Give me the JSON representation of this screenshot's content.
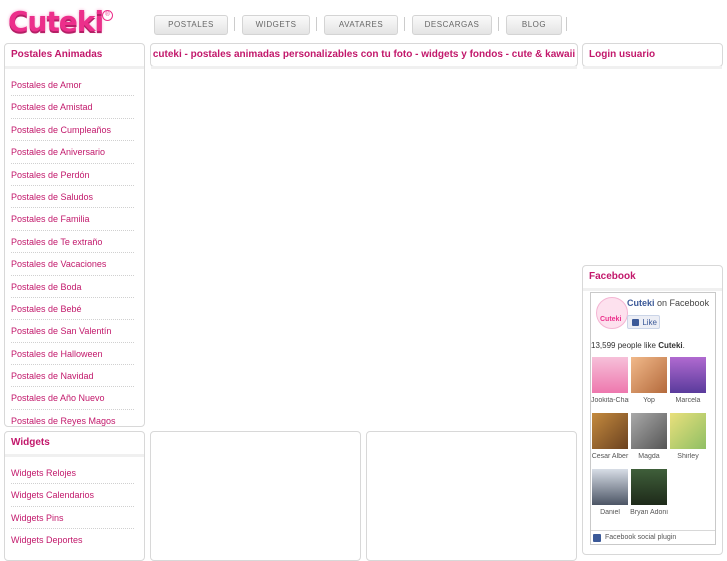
{
  "logo": {
    "text": "Cuteki",
    "reg": "®"
  },
  "nav": [
    "POSTALES",
    "WIDGETS",
    "AVATARES",
    "DESCARGAS",
    "BLOG"
  ],
  "postales": {
    "title": "Postales Animadas",
    "items": [
      "Postales de Amor",
      "Postales de Amistad",
      "Postales de Cumpleaños",
      "Postales de Aniversario",
      "Postales de Perdón",
      "Postales de Saludos",
      "Postales de Familia",
      "Postales de Te extraño",
      "Postales de Vacaciones",
      "Postales de Boda",
      "Postales de Bebé",
      "Postales de San Valentín",
      "Postales de Halloween",
      "Postales de Navidad",
      "Postales de Año Nuevo",
      "Postales de Reyes Magos"
    ]
  },
  "widgets": {
    "title": "Widgets",
    "items": [
      "Widgets Relojes",
      "Widgets Calendarios",
      "Widgets Pins",
      "Widgets Deportes"
    ]
  },
  "main": {
    "title": "cuteki - postales animadas personalizables con tu foto - widgets y fondos - cute & kawaii"
  },
  "login": {
    "title": "Login usuario"
  },
  "facebook": {
    "title": "Facebook",
    "page_name": "Cuteki",
    "on_facebook": "on Facebook",
    "like_label": "Like",
    "count_text": "13,599 people like",
    "count_name": "Cuteki",
    "count_dot": ".",
    "people": [
      "Jookita-Char",
      "Yop",
      "Marcela",
      "Cesar Alber",
      "Magda",
      "Shirley",
      "Daniel",
      "Bryan Adoni"
    ],
    "footer": "Facebook social plugin",
    "colors": {
      "fb_blue": "#3b5998"
    }
  },
  "colors": {
    "accent": "#c2186b",
    "brand": "#ec2f8b"
  }
}
